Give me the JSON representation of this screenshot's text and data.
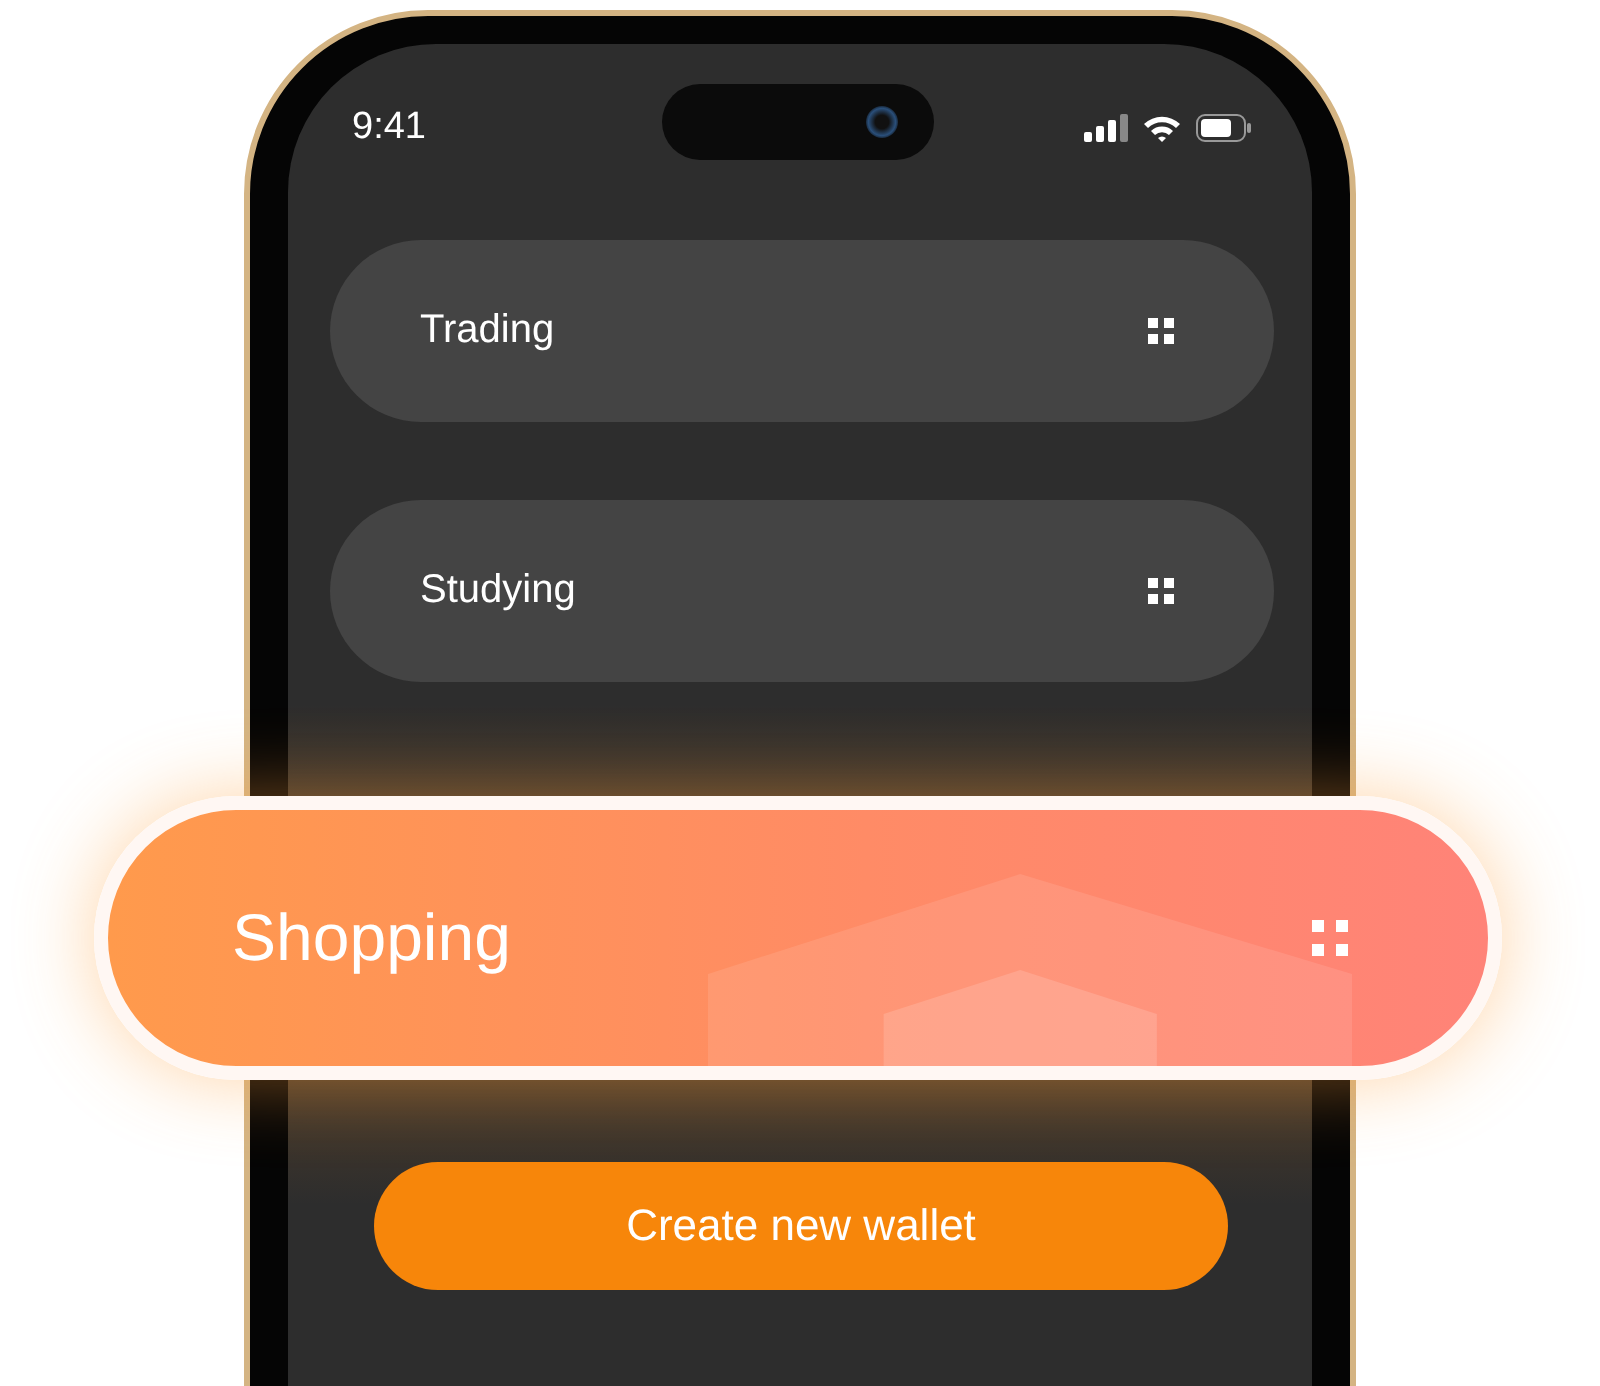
{
  "status_bar": {
    "time": "9:41"
  },
  "wallets": [
    {
      "name": "Trading",
      "selected": false
    },
    {
      "name": "Studying",
      "selected": false
    },
    {
      "name": "Shopping",
      "selected": true
    }
  ],
  "create_button": {
    "label": "Create new wallet"
  }
}
